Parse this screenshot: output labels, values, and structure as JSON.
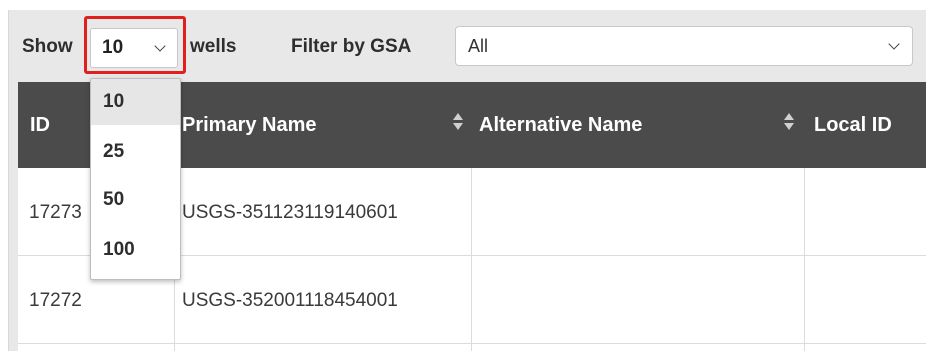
{
  "toolbar": {
    "show_label": "Show",
    "page_size_value": "10",
    "wells_label": "wells",
    "filter_label": "Filter by GSA",
    "gsa_value": "All"
  },
  "table": {
    "headers": [
      "ID",
      "Primary Name",
      "Alternative Name",
      "Local ID"
    ],
    "rows": [
      {
        "id": "17273",
        "primary": "USGS-351123119140601",
        "alt": "",
        "local": ""
      },
      {
        "id": "17272",
        "primary": "USGS-352001118454001",
        "alt": "",
        "local": ""
      }
    ]
  },
  "dropdown": {
    "options": [
      "10",
      "25",
      "50",
      "100"
    ],
    "selected": "10"
  },
  "colors": {
    "header_bg": "#4b4b4b",
    "highlight": "#e0201c",
    "toolbar_bg": "#e8e8e8"
  }
}
